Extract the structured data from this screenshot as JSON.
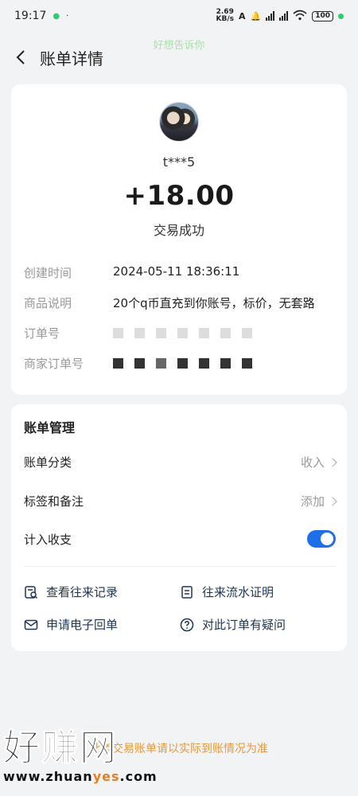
{
  "status_bar": {
    "time": "19:17",
    "net_speed": "2.69",
    "net_unit": "KB/s",
    "battery": "100"
  },
  "watermark_top": "好想告诉你",
  "header": {
    "title": "账单详情"
  },
  "transaction": {
    "username": "t***5",
    "amount": "+18.00",
    "status": "交易成功"
  },
  "details": {
    "created_label": "创建时间",
    "created_value": "2024-05-11 18:36:11",
    "desc_label": "商品说明",
    "desc_value": "20个q币直充到你账号，标价，无套路",
    "order_label": "订单号",
    "merchant_order_label": "商家订单号"
  },
  "management": {
    "title": "账单管理",
    "category_label": "账单分类",
    "category_value": "收入",
    "tags_label": "标签和备注",
    "tags_value": "添加",
    "include_label": "计入收支",
    "include_on": true
  },
  "links": {
    "records": "查看往来记录",
    "statement": "往来流水证明",
    "receipt": "申请电子回单",
    "question": "对此订单有疑问"
  },
  "bottom_note": "此类交易账单请以实际到账情况为准",
  "logo": {
    "text": "好赚网",
    "url_pre": "www.zhuan",
    "url_mid": "yes",
    "url_post": ".com"
  },
  "colors": {
    "accent": "#1e6fe8",
    "link_text": "#1f3552",
    "note": "#e49a3c"
  }
}
